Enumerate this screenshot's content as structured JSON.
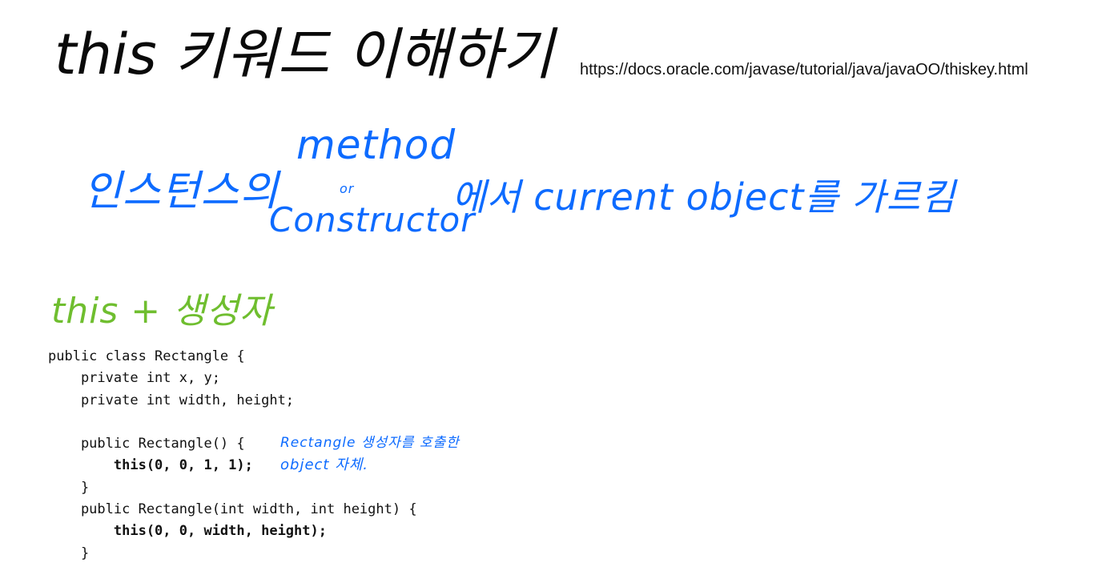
{
  "title": "this 키워드 이해하기",
  "url": "https://docs.oracle.com/javase/tutorial/java/javaOO/thiskey.html",
  "blue_note": {
    "instance": "인스턴스의",
    "method": "method",
    "or": "or",
    "constructor": "Constructor",
    "tail": "에서 current object를 가르킴"
  },
  "green_heading": "this + 생성자",
  "code": [
    "public class Rectangle {",
    "    private int x, y;",
    "    private int width, height;",
    "",
    "    public Rectangle() {",
    "        this(0, 0, 1, 1);",
    "    }",
    "    public Rectangle(int width, int height) {",
    "        this(0, 0, width, height);",
    "    }"
  ],
  "annotation": {
    "line1": "Rectangle 생성자를 호출한",
    "line2": "object 자체."
  },
  "colors": {
    "ink_black": "#0a0a0a",
    "ink_blue": "#0d6bff",
    "ink_green": "#6fbe2f"
  }
}
